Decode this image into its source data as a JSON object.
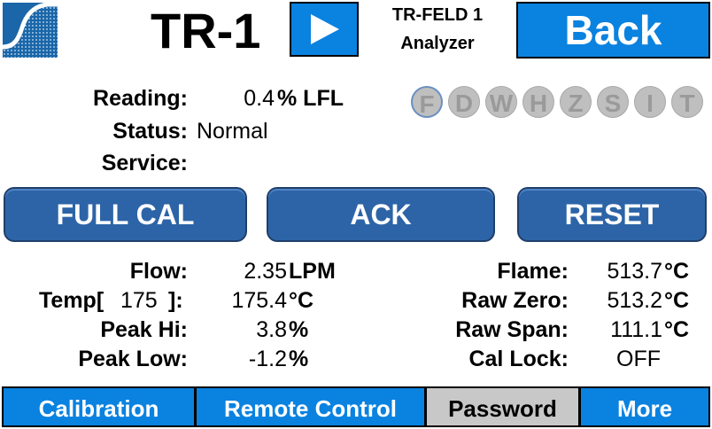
{
  "header": {
    "title": "TR-1",
    "device_name": "TR-FELD 1",
    "device_type": "Analyzer",
    "back_label": "Back",
    "play_icon": "play-icon",
    "logo_icon": "wave-logo-icon"
  },
  "reading": {
    "reading_label": "Reading:",
    "reading_value": "0.4",
    "reading_unit": "% LFL",
    "status_label": "Status:",
    "status_value": "Normal",
    "service_label": "Service:",
    "service_value": ""
  },
  "indicators": [
    "F",
    "D",
    "W",
    "H",
    "Z",
    "S",
    "I",
    "T"
  ],
  "actions": {
    "full_cal": "FULL CAL",
    "ack": "ACK",
    "reset": "RESET"
  },
  "measurements_left": {
    "flow_label": "Flow:",
    "flow_value": "2.35",
    "flow_unit": "LPM",
    "temp_label_prefix": "Temp[",
    "temp_setpoint": "175",
    "temp_label_suffix": "]:",
    "temp_value": "175.4",
    "temp_unit": "°C",
    "peak_hi_label": "Peak Hi:",
    "peak_hi_value": "3.8",
    "peak_hi_unit": "%",
    "peak_low_label": "Peak Low:",
    "peak_low_value": "-1.2",
    "peak_low_unit": "%"
  },
  "measurements_right": {
    "flame_label": "Flame:",
    "flame_value": "513.7",
    "flame_unit": "°C",
    "raw_zero_label": "Raw Zero:",
    "raw_zero_value": "513.2",
    "raw_zero_unit": "°C",
    "raw_span_label": "Raw Span:",
    "raw_span_value": "111.1",
    "raw_span_unit": "°C",
    "cal_lock_label": "Cal Lock:",
    "cal_lock_value": "OFF"
  },
  "nav": {
    "calibration": "Calibration",
    "remote_control": "Remote Control",
    "password": "Password",
    "more": "More"
  },
  "colors": {
    "accent_blue": "#0a82e0",
    "action_blue": "#2d64a7",
    "logo_blue": "#1a66a8",
    "nav_gray": "#c8c8c8",
    "indicator_gray": "#bfbfbf"
  }
}
